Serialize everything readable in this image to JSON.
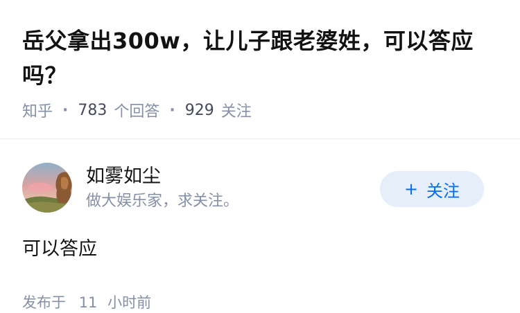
{
  "question": {
    "title": "岳父拿出300w，让儿子跟老婆姓，可以答应吗？",
    "source": "知乎",
    "answer_count": "783",
    "answer_label": "个回答",
    "follower_count": "929",
    "follower_label": "关注"
  },
  "author": {
    "avatar_icon": "avatar-landscape-image",
    "name": "如雾如尘",
    "bio": "做大娱乐家，求关注。",
    "follow_label": "关注",
    "follow_icon": "plus-icon",
    "accent_color": "#056de8",
    "button_bg": "#e5eef9"
  },
  "answer": {
    "content": "可以答应",
    "publish_label": "发布于",
    "time_value": "11",
    "time_unit": "小时前"
  },
  "colors": {
    "title": "#121212",
    "meta": "#8590a6"
  }
}
